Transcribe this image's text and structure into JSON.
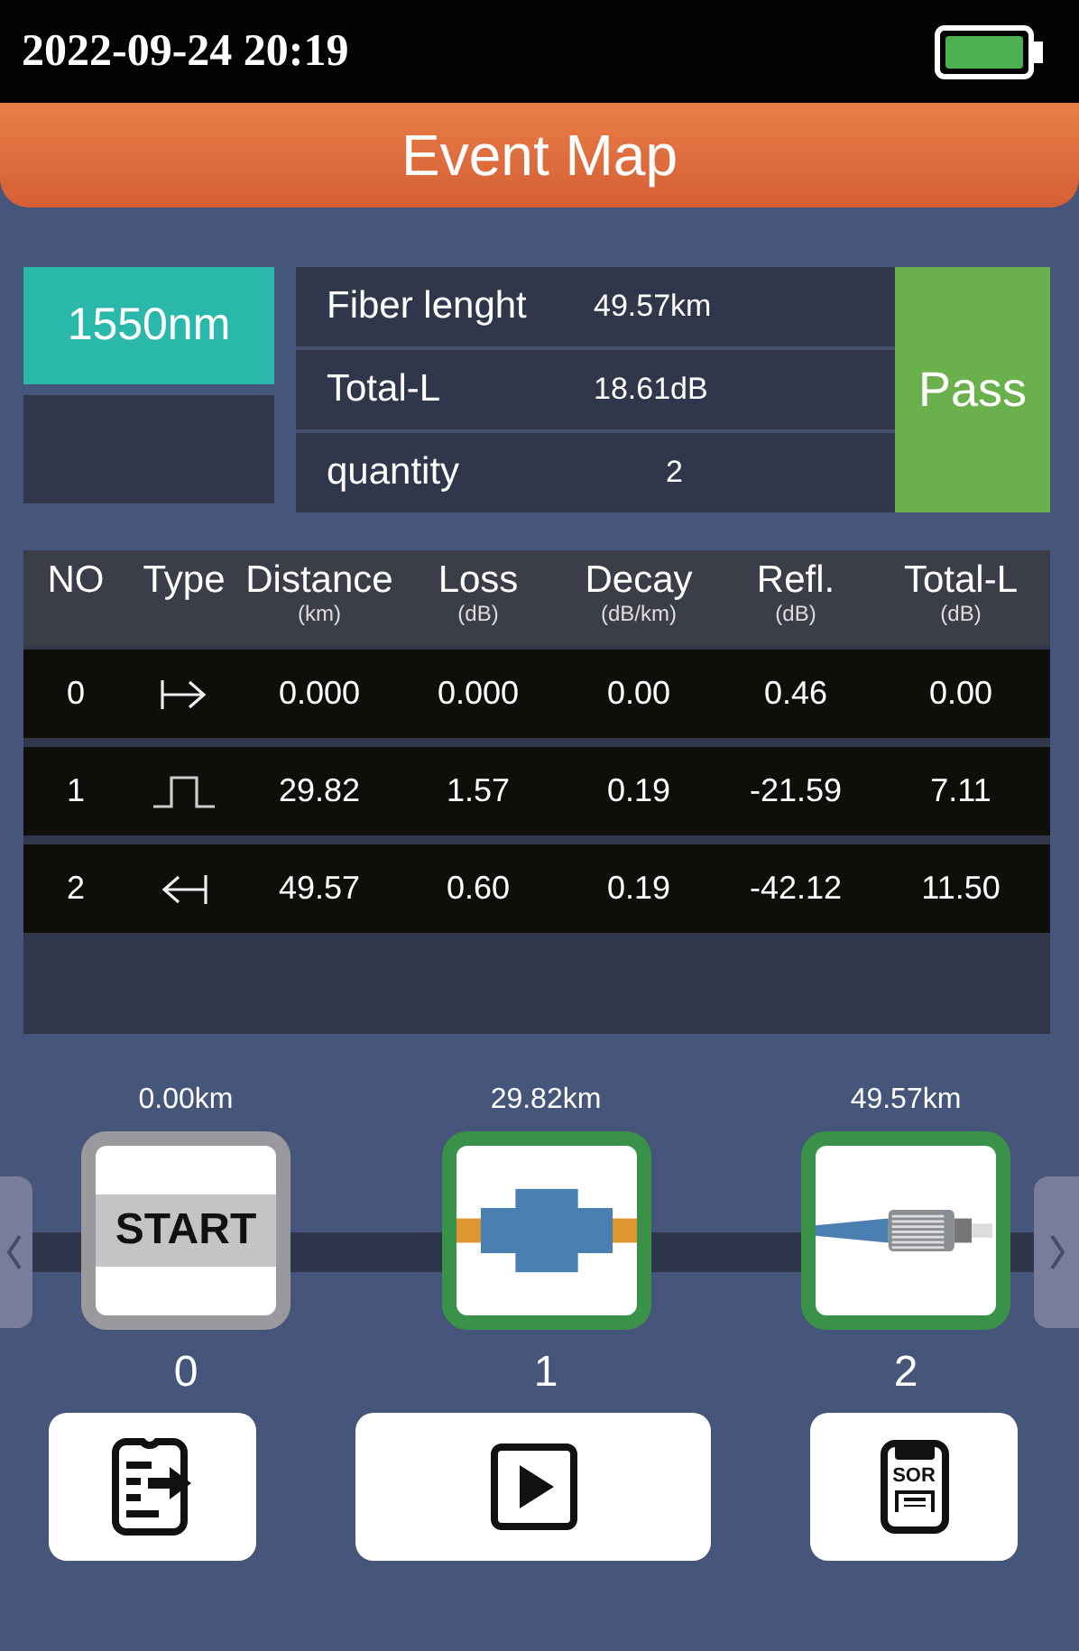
{
  "status_bar": {
    "datetime": "2022-09-24 20:19"
  },
  "header": {
    "title": "Event Map"
  },
  "summary": {
    "wavelength": "1550nm",
    "rows": [
      {
        "label": "Fiber lenght",
        "value": "49.57km"
      },
      {
        "label": "Total-L",
        "value": "18.61dB"
      },
      {
        "label": "quantity",
        "value": "2"
      }
    ],
    "result": "Pass"
  },
  "table": {
    "columns": [
      {
        "title": "NO"
      },
      {
        "title": "Type"
      },
      {
        "title": "Distance",
        "unit": "(km)"
      },
      {
        "title": "Loss",
        "unit": "(dB)"
      },
      {
        "title": "Decay",
        "unit": "(dB/km)"
      },
      {
        "title": "Refl.",
        "unit": "(dB)"
      },
      {
        "title": "Total-L",
        "unit": "(dB)"
      }
    ],
    "rows": [
      {
        "no": "0",
        "kind": "start",
        "distance": "0.000",
        "loss": "0.000",
        "decay": "0.00",
        "refl": "0.46",
        "total": "0.00"
      },
      {
        "no": "1",
        "kind": "connector",
        "distance": "29.82",
        "loss": "1.57",
        "decay": "0.19",
        "refl": "-21.59",
        "total": "7.11"
      },
      {
        "no": "2",
        "kind": "end",
        "distance": "49.57",
        "loss": "0.60",
        "decay": "0.19",
        "refl": "-42.12",
        "total": "11.50"
      }
    ]
  },
  "event_map": [
    {
      "distance": "0.00km",
      "kind": "start",
      "label": "START",
      "color": "#9a9a9e",
      "index": "0"
    },
    {
      "distance": "29.82km",
      "kind": "connector",
      "color": "#3a9148",
      "index": "1"
    },
    {
      "distance": "49.57km",
      "kind": "end",
      "color": "#3a9148",
      "index": "2"
    }
  ],
  "toolbar": {
    "sor_label": "SOR"
  }
}
